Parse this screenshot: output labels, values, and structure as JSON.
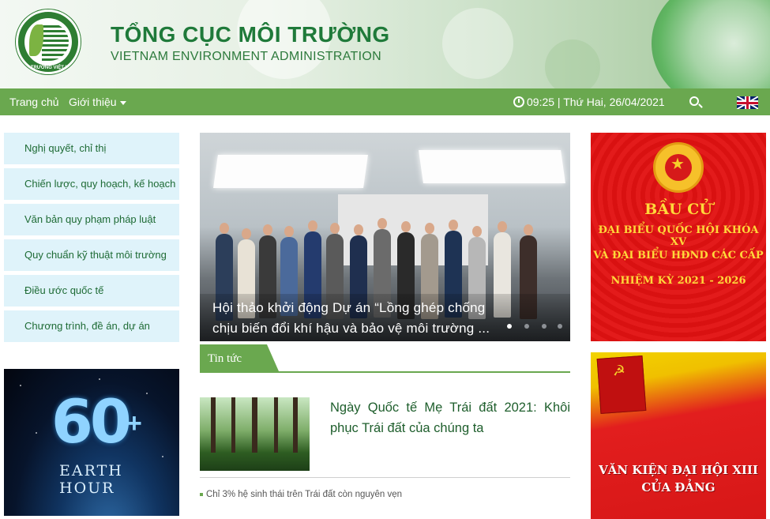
{
  "header": {
    "title": "TỔNG CỤC MÔI TRƯỜNG",
    "subtitle": "VIETNAM ENVIRONMENT ADMINISTRATION",
    "logo_text": "MÔI TRƯỜNG VIỆT NAM"
  },
  "nav": {
    "home": "Trang chủ",
    "about": "Giới thiệu",
    "datetime": "09:25 | Thứ Hai, 26/04/2021"
  },
  "sidebar": {
    "items": [
      {
        "label": "Nghị quyết, chỉ thị"
      },
      {
        "label": "Chiến lược, quy hoạch, kế hoạch"
      },
      {
        "label": "Văn bản quy phạm pháp luật"
      },
      {
        "label": "Quy chuẩn kỹ thuật môi trường"
      },
      {
        "label": "Điều ước quốc tế"
      },
      {
        "label": "Chương trình, đề án, dự án"
      }
    ],
    "earth_hour": {
      "number": "60",
      "plus": "+",
      "line1": "EARTH",
      "line2": "HOUR"
    }
  },
  "slider": {
    "caption_line1": "Hội thảo khởi động Dự án “Lồng ghép chống",
    "caption_line2": "chịu biến đổi khí hậu và bảo vệ môi trường ..."
  },
  "news": {
    "tab_label": "Tin tức",
    "featured_title": "Ngày Quốc tế Mẹ Trái đất 2021: Khôi phục Trái đất của chúng ta",
    "bullets": [
      "Chỉ 3% hệ sinh thái trên Trái đất còn nguyên vẹn"
    ]
  },
  "banners": {
    "election": {
      "line1": "BẦU CỬ",
      "line2": "ĐẠI BIỂU QUỐC HỘI KHÓA XV",
      "line3": "VÀ ĐẠI BIỂU HĐND CÁC CẤP",
      "line4": "NHIỆM KỲ 2021 - 2026"
    },
    "party": {
      "line1": "VĂN KIỆN ĐẠI HỘI XIII",
      "line2": "CỦA ĐẢNG"
    }
  },
  "colors": {
    "nav_green": "#6aa84f",
    "title_green": "#1f7a3a",
    "menu_bg": "#dff3fa",
    "banner_red": "#e31b1b",
    "banner_gold": "#ffd83a"
  }
}
